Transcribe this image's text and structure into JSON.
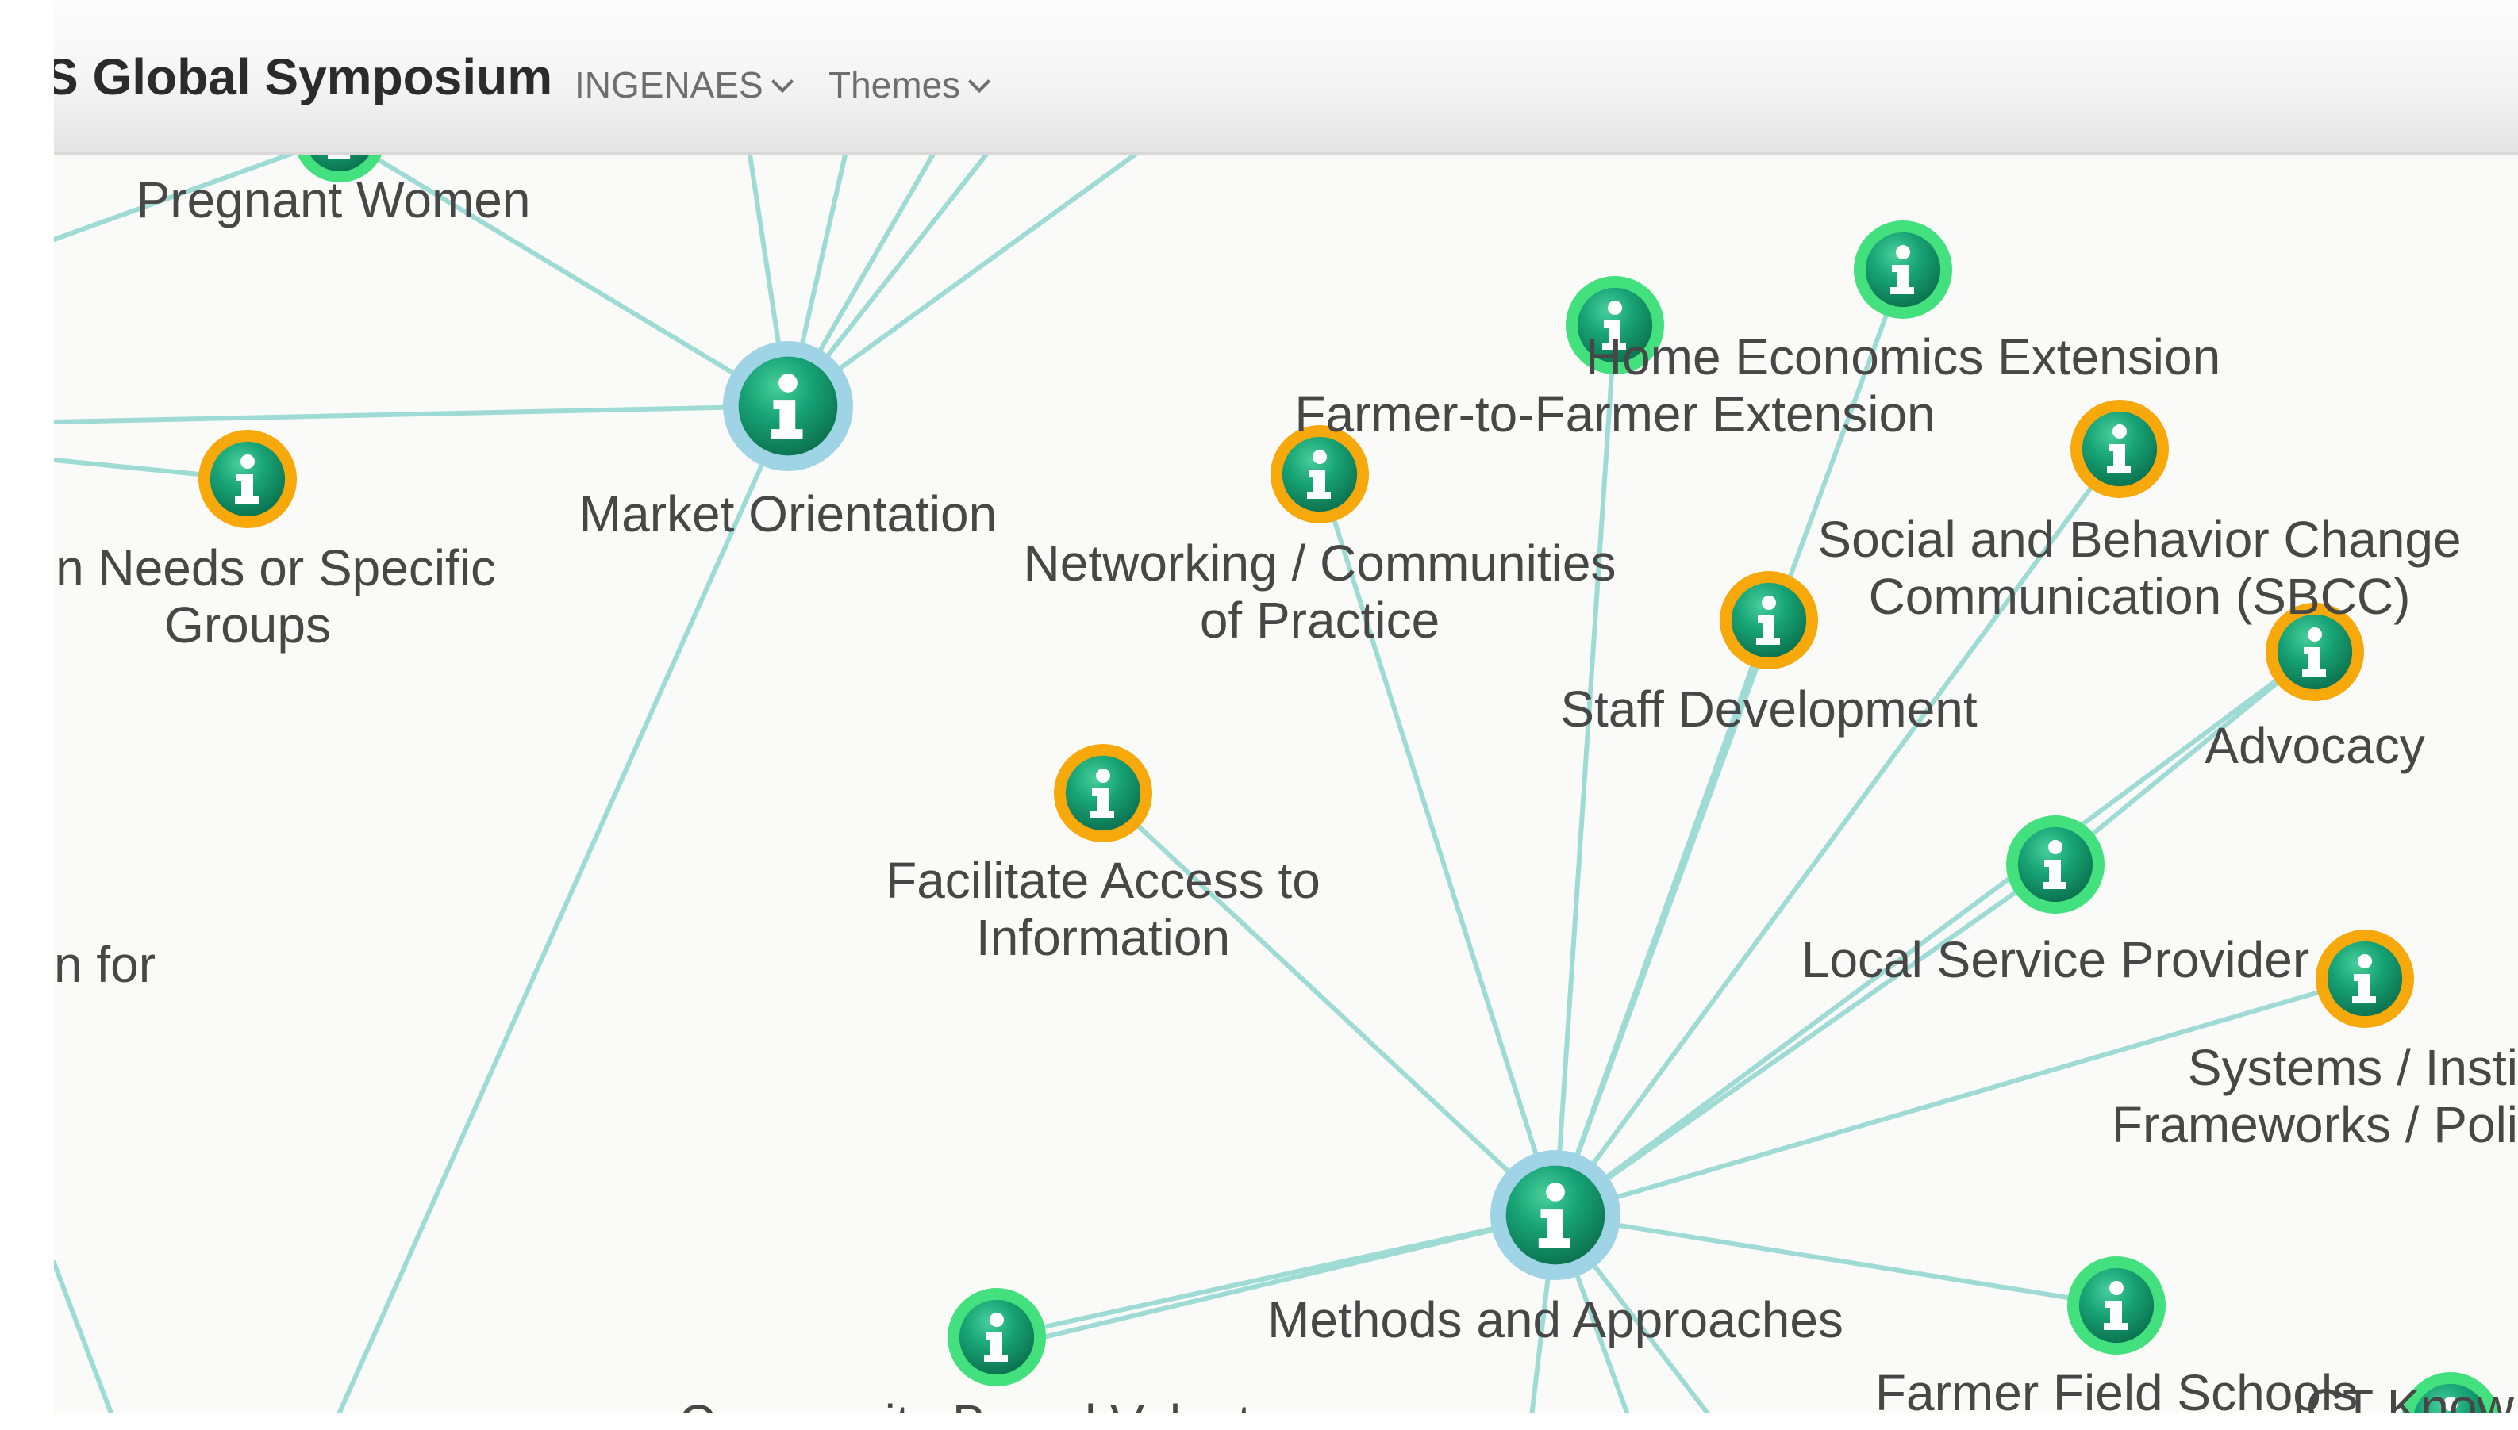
{
  "header": {
    "brand": "S Global Symposium",
    "nav": [
      {
        "label": "INGENAES"
      },
      {
        "label": "Themes"
      }
    ]
  },
  "colors": {
    "edge": "#9ddbd4",
    "node_fill": "#15a071",
    "ring_green": "#43e07e",
    "ring_orange": "#f7a80b",
    "ring_blue": "#9fd3e6",
    "label": "#474747"
  },
  "graph": {
    "nodes": [
      {
        "id": "pregnant-women",
        "label": "Pregnant Women",
        "ring": "green",
        "icon": "info-icon"
      },
      {
        "id": "market-orientation",
        "label": "Market Orientation",
        "ring": "blue",
        "icon": "info-icon"
      },
      {
        "id": "needs-groups",
        "label_lines": [
          ": on Needs or Specific",
          "Groups"
        ],
        "ring": "orange",
        "icon": "info-icon"
      },
      {
        "id": "farmer-to-farmer",
        "label": "Farmer-to-Farmer Extension",
        "ring": "green",
        "icon": "info-icon"
      },
      {
        "id": "home-economics",
        "label": "Home Economics Extension",
        "ring": "green",
        "icon": "info-icon"
      },
      {
        "id": "networking",
        "label_lines": [
          "Networking / Communities",
          "of Practice"
        ],
        "ring": "orange",
        "icon": "info-icon"
      },
      {
        "id": "sbcc",
        "label_lines": [
          "Social and Behavior Change",
          "Communication (SBCC)"
        ],
        "ring": "orange",
        "icon": "info-icon"
      },
      {
        "id": "staff-development",
        "label": "Staff Development",
        "ring": "orange",
        "icon": "info-icon"
      },
      {
        "id": "advocacy",
        "label": "Advocacy",
        "ring": "orange",
        "icon": "info-icon"
      },
      {
        "id": "facilitate-access",
        "label_lines": [
          "Facilitate Access to",
          "Information"
        ],
        "ring": "orange",
        "icon": "info-icon"
      },
      {
        "id": "local-service",
        "label": "Local Service Provider",
        "ring": "green",
        "icon": "info-icon"
      },
      {
        "id": "systems",
        "label_lines": [
          "Systems / Insti",
          "Frameworks / Poli"
        ],
        "ring": "orange",
        "icon": "info-icon"
      },
      {
        "id": "methods-approaches",
        "label": "Methods and Approaches",
        "ring": "blue",
        "icon": "info-icon"
      },
      {
        "id": "community-based",
        "label": "Community-Based Volunt",
        "ring": "green",
        "icon": "info-icon"
      },
      {
        "id": "farmer-field",
        "label": "Farmer Field Schools",
        "ring": "green",
        "icon": "info-icon"
      },
      {
        "id": "ict-knowledge",
        "label": "ICT Know",
        "ring": "green",
        "icon": "info-icon"
      }
    ],
    "partial_labels": [
      {
        "id": "n-for",
        "label": "n for"
      }
    ]
  }
}
